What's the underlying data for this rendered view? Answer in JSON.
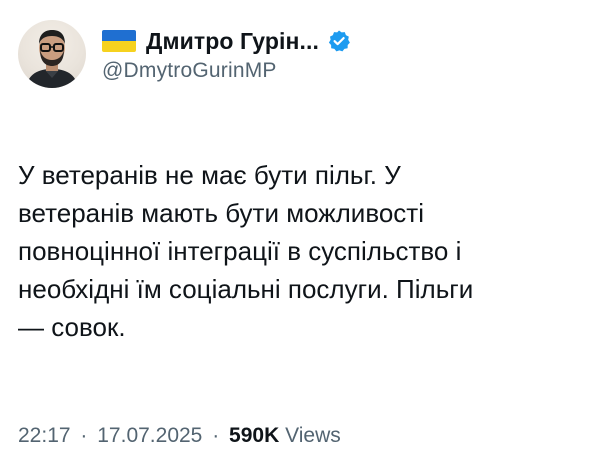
{
  "author": {
    "display_name": "Дмитро Гурін...",
    "handle": "@DmytroGurinMP",
    "verified": true,
    "flag": "ukraine-flag-icon",
    "avatar": "avatar"
  },
  "tweet": {
    "text": "У ветеранів не має бути пільг. У\nветеранів мають бути можливості\nповноцінної інтеграції в суспільство і\nнеобхідні їм соціальні послуги. Пільги\n— совок."
  },
  "meta": {
    "time": "22:17",
    "separator": "·",
    "date": "17.07.2025",
    "views_count": "590K",
    "views_label": "Views"
  },
  "colors": {
    "text": "#0f1419",
    "secondary": "#536471",
    "verified": "#1d9bf0",
    "flag_blue": "#1f6fd1",
    "flag_yellow": "#f6d21f"
  }
}
